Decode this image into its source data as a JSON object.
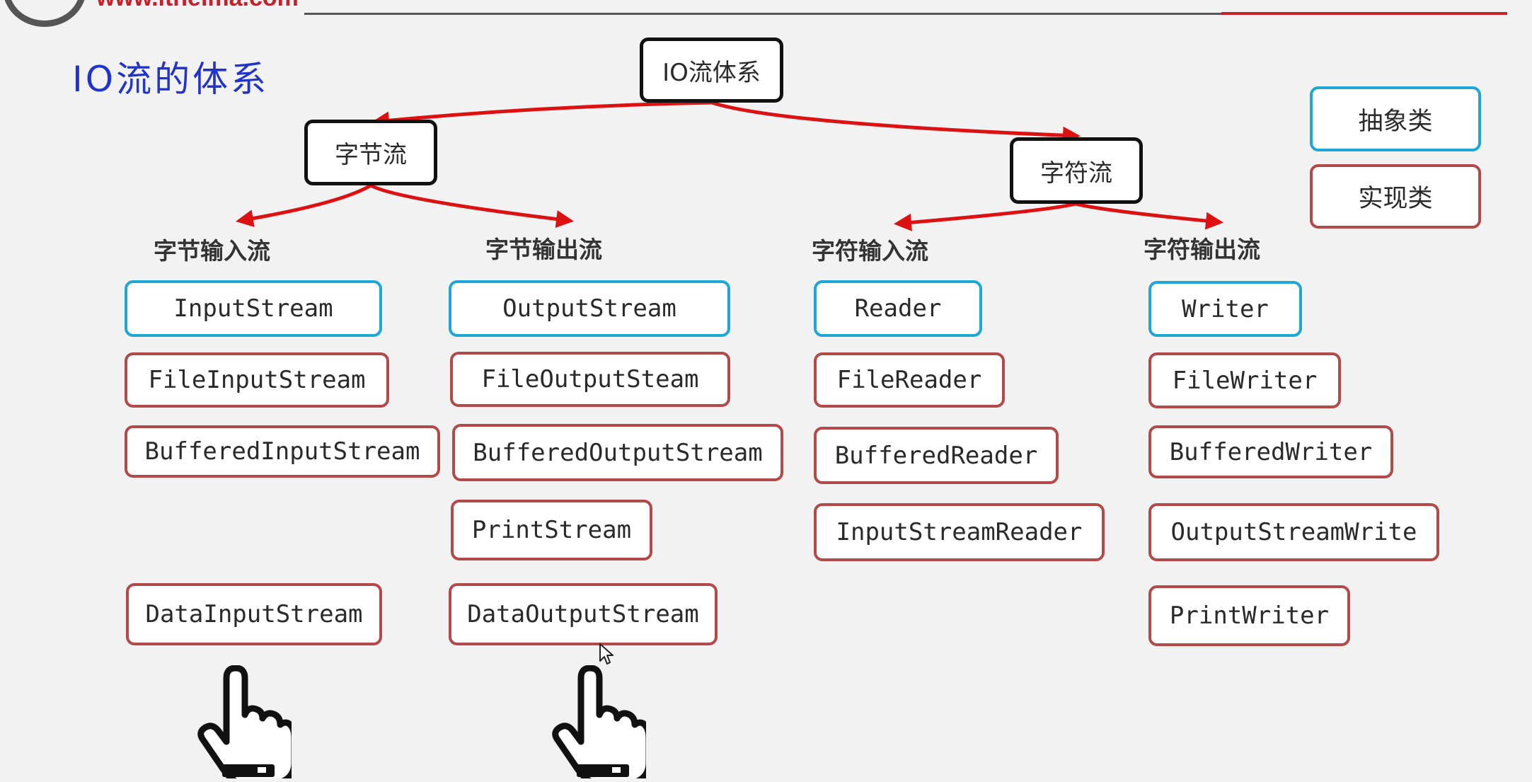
{
  "header": {
    "logo_text": "www.itheima.com"
  },
  "slide_title": "IO流的体系",
  "root": "IO流体系",
  "branches": [
    {
      "label": "字节流"
    },
    {
      "label": "字符流"
    }
  ],
  "categories": [
    {
      "label": "字节输入流",
      "abstract_class": "InputStream",
      "impl_classes": [
        "FileInputStream",
        "BufferedInputStream",
        "DataInputStream"
      ]
    },
    {
      "label": "字节输出流",
      "abstract_class": "OutputStream",
      "impl_classes": [
        "FileOutputSteam",
        "BufferedOutputStream",
        "PrintStream",
        "DataOutputStream"
      ]
    },
    {
      "label": "字符输入流",
      "abstract_class": "Reader",
      "impl_classes": [
        "FileReader",
        "BufferedReader",
        "InputStreamReader"
      ]
    },
    {
      "label": "字符输出流",
      "abstract_class": "Writer",
      "impl_classes": [
        "FileWriter",
        "BufferedWriter",
        "OutputStreamWrite",
        "PrintWriter"
      ]
    }
  ],
  "legend": {
    "abstract": "抽象类",
    "implementation": "实现类"
  },
  "colors": {
    "abstract_border": "#1ea7d6",
    "impl_border": "#b34a4a",
    "root_border": "#111111",
    "connector": "#dd1111",
    "title": "#2233cc",
    "brand": "#c8202a"
  },
  "icons": [
    "pointing-hand-icon",
    "pointing-hand-icon",
    "mouse-cursor-icon"
  ]
}
